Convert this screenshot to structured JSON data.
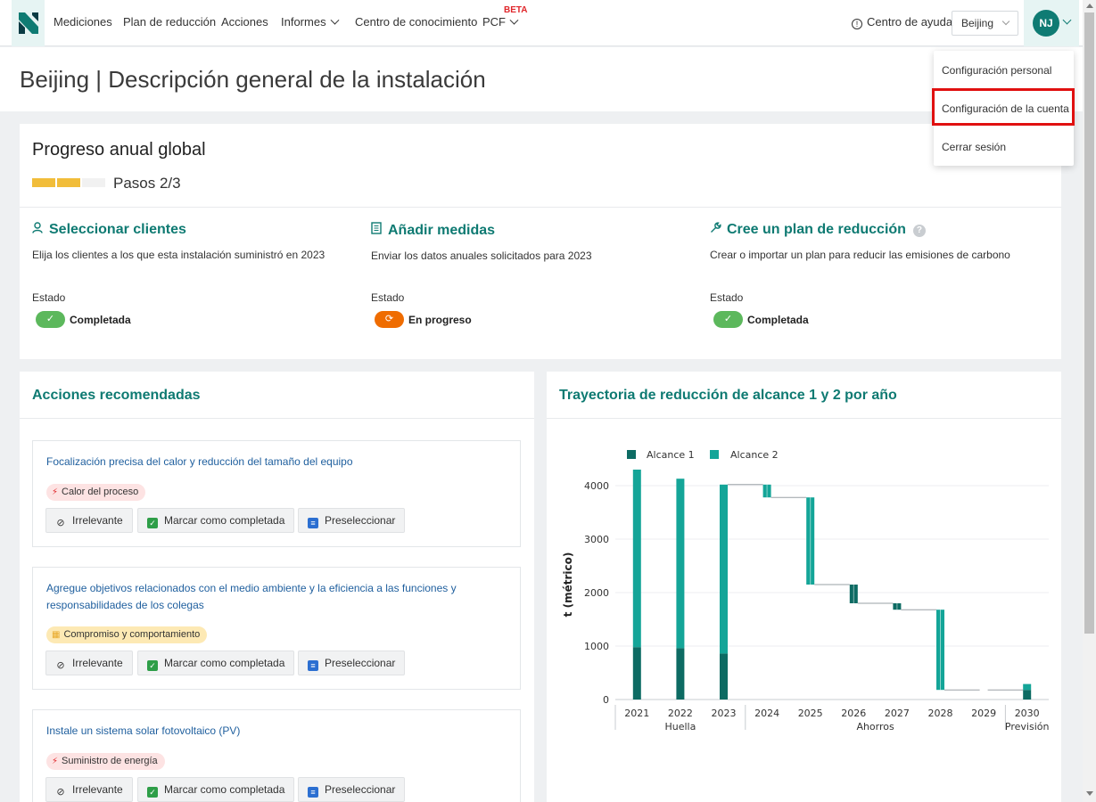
{
  "nav": {
    "items": [
      {
        "label": "Mediciones",
        "dropdown": false
      },
      {
        "label": "Plan de reducción",
        "dropdown": false
      },
      {
        "label": "Acciones",
        "dropdown": false
      },
      {
        "label": "Informes",
        "dropdown": true
      },
      {
        "label": "Centro de conocimiento",
        "dropdown": false
      },
      {
        "label": "PCF",
        "dropdown": true
      }
    ],
    "beta_badge": "BETA",
    "help_label": "Centro de ayuda",
    "site_selector": "Beijing",
    "avatar_initials": "NJ"
  },
  "user_menu": {
    "items": [
      "Configuración personal",
      "Configuración de la cuenta",
      "Cerrar sesión"
    ],
    "highlighted_item": "Configuración de la cuenta"
  },
  "page_title": "Beijing | Descripción general de la instalación",
  "progress": {
    "title": "Progreso anual global",
    "steps_text": "Pasos 2/3",
    "steps_done": 2,
    "steps_total": 3,
    "steps": [
      {
        "title": "Seleccionar clientes",
        "icon": "user-icon",
        "description": "Elija los clientes a los que esta instalación suministró en 2023",
        "estado_label": "Estado",
        "status": "Completada",
        "status_color": "#5cb85c",
        "status_icon": "check-icon"
      },
      {
        "title": "Añadir medidas",
        "icon": "document-icon",
        "description": "Enviar los datos anuales solicitados para 2023",
        "estado_label": "Estado",
        "status": "En progreso",
        "status_color": "#ef6c00",
        "status_icon": "sync-icon"
      },
      {
        "title": "Cree un plan de reducción",
        "icon": "wrench-icon",
        "description": "Crear o importar un plan para reducir las emisiones de carbono",
        "estado_label": "Estado",
        "status": "Completada",
        "status_color": "#5cb85c",
        "status_icon": "check-icon",
        "help_icon": true
      }
    ]
  },
  "actions": {
    "title": "Acciones recomendadas",
    "button_labels": {
      "irrelevant": "Irrelevante",
      "complete": "Marcar como completada",
      "shortlist": "Preseleccionar"
    },
    "items": [
      {
        "title": "Focalización precisa del calor y reducción del tamaño del equipo",
        "tag": "Calor del proceso",
        "tag_color": "#fde3e3",
        "tag_icon_color": "#e0262a"
      },
      {
        "title": "Agregue objetivos relacionados con el medio ambiente y la eficiencia a las funciones y responsabilidades de los colegas",
        "tag": "Compromiso y comportamiento",
        "tag_color": "#fde9b4",
        "tag_icon_color": "#e8a92a"
      },
      {
        "title": "Instale un sistema solar fotovoltaico (PV)",
        "tag": "Suministro de energía",
        "tag_color": "#fde3e3",
        "tag_icon_color": "#e0262a"
      }
    ]
  },
  "trajectory": {
    "title": "Trayectoria de reducción de alcance 1 y 2 por año"
  },
  "chart_data": {
    "type": "bar",
    "subtype": "waterfall",
    "title": "",
    "ylabel": "t (métrico)",
    "ylim": [
      0,
      4300
    ],
    "yticks": [
      0,
      1000,
      2000,
      3000,
      4000
    ],
    "legend_position": "top-left",
    "grid": true,
    "categories": [
      "2021",
      "2022",
      "2023",
      "2024",
      "2025",
      "2026",
      "2027",
      "2028",
      "2029",
      "2030"
    ],
    "groups": [
      {
        "label": "Huella",
        "categories": [
          "2021",
          "2022",
          "2023"
        ]
      },
      {
        "label": "Ahorros",
        "categories": [
          "2024",
          "2025",
          "2026",
          "2027",
          "2028",
          "2029"
        ]
      },
      {
        "label": "Previsión",
        "categories": [
          "2030"
        ]
      }
    ],
    "series": [
      {
        "name": "Alcance 1",
        "color": "#0d6b63"
      },
      {
        "name": "Alcance 2",
        "color": "#14a598"
      }
    ],
    "footprint": [
      {
        "year": "2021",
        "alcance1": 980,
        "alcance2": 3320
      },
      {
        "year": "2022",
        "alcance1": 960,
        "alcance2": 3170
      },
      {
        "year": "2023",
        "alcance1": 860,
        "alcance2": 3160
      }
    ],
    "savings": [
      {
        "year": "2024",
        "from": 4020,
        "to": 3780,
        "scope": "Alcance 2"
      },
      {
        "year": "2025",
        "from": 3780,
        "to": 2150,
        "scope": "Alcance 2"
      },
      {
        "year": "2026",
        "from": 2150,
        "to": 1800,
        "scope": "Alcance 1"
      },
      {
        "year": "2027",
        "from": 1800,
        "to": 1680,
        "scope": "Alcance 1"
      },
      {
        "year": "2028",
        "from": 1680,
        "to": 180,
        "scope": "Alcance 2"
      },
      {
        "year": "2029",
        "from": 180,
        "to": 180,
        "scope": "none"
      }
    ],
    "forecast": {
      "year": "2030",
      "alcance1": 180,
      "alcance2": 110
    }
  }
}
